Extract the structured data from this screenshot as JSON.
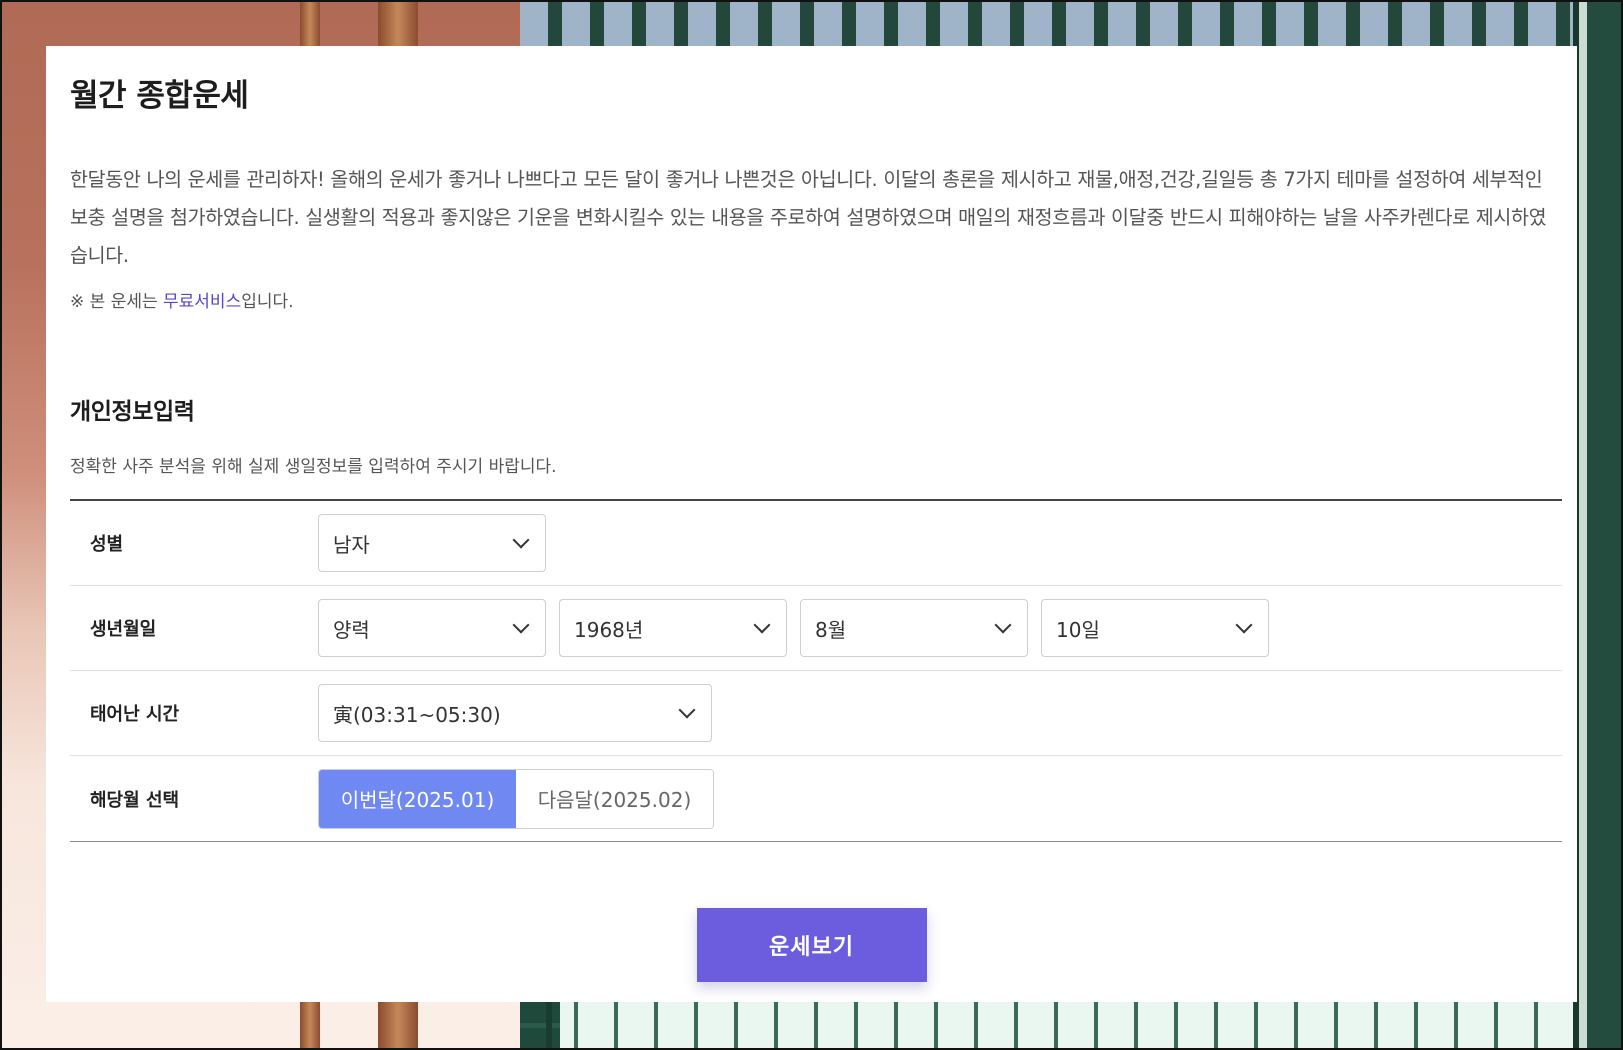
{
  "page": {
    "title": "월간 종합운세",
    "intro": "한달동안 나의 운세를 관리하자! 올해의 운세가 좋거나 나쁘다고 모든 달이 좋거나 나쁜것은 아닙니다. 이달의 총론을 제시하고 재물,애정,건강,길일등 총 7가지 테마를 설정하여 세부적인 보충 설명을 첨가하였습니다. 실생활의 적용과 좋지않은 기운을 변화시킬수 있는 내용을 주로하여 설명하였으며 매일의 재정흐름과 이달중 반드시 피해야하는 날을 사주카렌다로 제시하였습니다.",
    "notice_prefix": "※ 본 운세는 ",
    "notice_link": "무료서비스",
    "notice_suffix": "입니다."
  },
  "form": {
    "title": "개인정보입력",
    "description": "정확한 사주 분석을 위해 실제 생일정보를 입력하여 주시기 바랍니다.",
    "gender": {
      "label": "성별",
      "value": "남자"
    },
    "birth": {
      "label": "생년월일",
      "calendar": "양력",
      "year": "1968년",
      "month": "8월",
      "day": "10일"
    },
    "time": {
      "label": "태어난 시간",
      "value": "寅(03:31~05:30)"
    },
    "month_select": {
      "label": "해당월 선택",
      "options": [
        "이번달(2025.01)",
        "다음달(2025.02)"
      ],
      "selected": "이번달(2025.01)"
    },
    "submit_label": "운세보기"
  },
  "colors": {
    "accent": "#6c5ddf",
    "toggle_active": "#6f88f2",
    "link": "#5548c8"
  }
}
